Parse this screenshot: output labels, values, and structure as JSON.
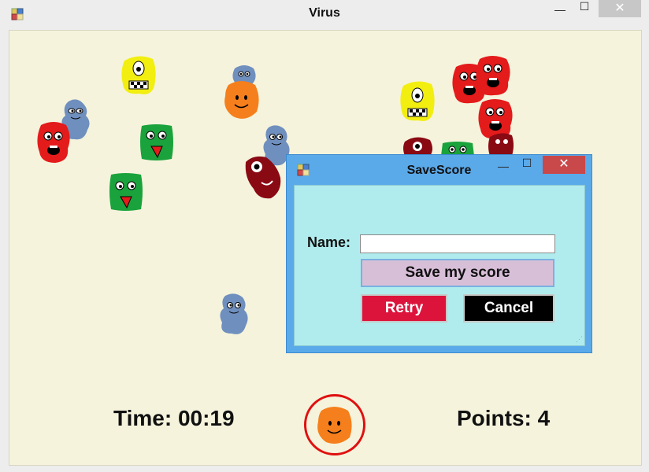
{
  "window": {
    "title": "Virus",
    "minimize": "—",
    "maximize": "☐",
    "close": "✕"
  },
  "hud": {
    "time": "Time: 00:19",
    "points": "Points: 4"
  },
  "dialog": {
    "title": "SaveScore",
    "name_label": "Name:",
    "name_value": "",
    "save_label": "Save my score",
    "retry_label": "Retry",
    "cancel_label": "Cancel",
    "minimize": "—",
    "maximize": "☐",
    "close": "✕"
  },
  "colors": {
    "field_bg": "#f5f3dc",
    "virus_red": "#e31b1b",
    "virus_yellow": "#f2ee10",
    "virus_green": "#1aa33c",
    "virus_blue": "#6f8fbe",
    "virus_orange": "#f57f1c",
    "virus_darkred": "#8a0a14",
    "target_ring": "#e01010"
  }
}
